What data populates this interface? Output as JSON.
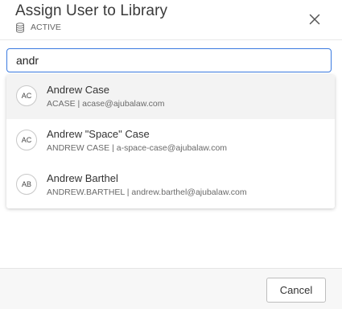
{
  "dialog": {
    "title": "Assign User to Library",
    "status_label": "ACTIVE",
    "status_icon": "database-icon",
    "close_icon": "close-icon"
  },
  "search": {
    "value": "andr"
  },
  "results": [
    {
      "initials": "AC",
      "name": "Andrew Case",
      "detail": "ACASE | acase@ajubalaw.com",
      "highlighted": true
    },
    {
      "initials": "AC",
      "name": "Andrew \"Space\" Case",
      "detail": "ANDREW CASE | a-space-case@ajubalaw.com",
      "highlighted": false
    },
    {
      "initials": "AB",
      "name": "Andrew Barthel",
      "detail": "ANDREW.BARTHEL | andrew.barthel@ajubalaw.com",
      "highlighted": false
    }
  ],
  "footer": {
    "cancel_label": "Cancel"
  },
  "colors": {
    "focus_border": "#3b7be0",
    "highlight_row": "#f3f3f3",
    "footer_bg": "#f7f7f7"
  }
}
